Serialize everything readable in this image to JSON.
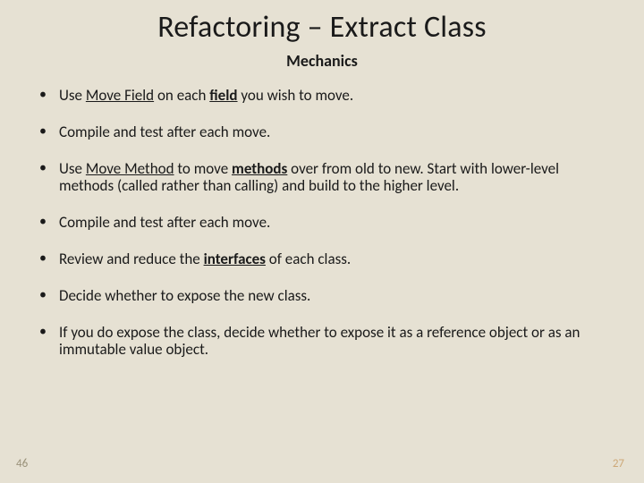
{
  "title": "Refactoring – Extract Class",
  "subtitle": "Mechanics",
  "bullets": [
    {
      "segments": [
        {
          "text": "Use "
        },
        {
          "text": "Move Field",
          "underline": true
        },
        {
          "text": " on each "
        },
        {
          "text": "field",
          "bold": true,
          "underline": true
        },
        {
          "text": " you wish to move."
        }
      ]
    },
    {
      "segments": [
        {
          "text": "Compile and test after each move."
        }
      ]
    },
    {
      "segments": [
        {
          "text": "Use "
        },
        {
          "text": "Move Method",
          "underline": true
        },
        {
          "text": " to move "
        },
        {
          "text": "methods",
          "bold": true,
          "underline": true
        },
        {
          "text": " over from old to new. Start with lower-level methods (called rather than calling) and build to the higher level."
        }
      ]
    },
    {
      "segments": [
        {
          "text": "Compile and test after each move."
        }
      ]
    },
    {
      "segments": [
        {
          "text": "Review and reduce the "
        },
        {
          "text": "interfaces",
          "bold": true,
          "underline": true
        },
        {
          "text": " of each class."
        }
      ]
    },
    {
      "segments": [
        {
          "text": "Decide whether to expose the new class."
        }
      ]
    },
    {
      "segments": [
        {
          "text": "If you do expose the class, decide whether to expose it as a reference object or as an immutable value object."
        }
      ]
    }
  ],
  "pageLeft": "46",
  "pageRight": "27"
}
